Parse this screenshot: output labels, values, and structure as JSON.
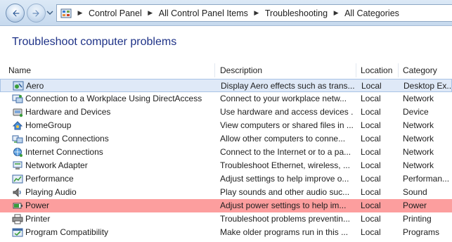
{
  "breadcrumb": [
    "Control Panel",
    "All Control Panel Items",
    "Troubleshooting",
    "All Categories"
  ],
  "page": {
    "title": "Troubleshoot computer problems"
  },
  "columns": {
    "name": "Name",
    "description": "Description",
    "location": "Location",
    "category": "Category"
  },
  "rows": [
    {
      "name": "Aero",
      "description": "Display Aero effects such as trans...",
      "location": "Local",
      "category": "Desktop Ex...",
      "icon": "aero-icon",
      "state": "selected"
    },
    {
      "name": "Connection to a Workplace Using DirectAccess",
      "description": "Connect to your workplace netw...",
      "location": "Local",
      "category": "Network",
      "icon": "directaccess-icon",
      "state": ""
    },
    {
      "name": "Hardware and Devices",
      "description": "Use hardware and access devices ...",
      "location": "Local",
      "category": "Device",
      "icon": "hardware-icon",
      "state": ""
    },
    {
      "name": "HomeGroup",
      "description": "View computers or shared files in ...",
      "location": "Local",
      "category": "Network",
      "icon": "homegroup-icon",
      "state": ""
    },
    {
      "name": "Incoming Connections",
      "description": "Allow other computers to conne...",
      "location": "Local",
      "category": "Network",
      "icon": "incoming-connections-icon",
      "state": ""
    },
    {
      "name": "Internet Connections",
      "description": "Connect to the Internet or to a pa...",
      "location": "Local",
      "category": "Network",
      "icon": "internet-connections-icon",
      "state": ""
    },
    {
      "name": "Network Adapter",
      "description": "Troubleshoot Ethernet, wireless, ...",
      "location": "Local",
      "category": "Network",
      "icon": "network-adapter-icon",
      "state": ""
    },
    {
      "name": "Performance",
      "description": "Adjust settings to help improve o...",
      "location": "Local",
      "category": "Performan...",
      "icon": "performance-icon",
      "state": ""
    },
    {
      "name": "Playing Audio",
      "description": "Play sounds and other audio suc...",
      "location": "Local",
      "category": "Sound",
      "icon": "audio-icon",
      "state": ""
    },
    {
      "name": "Power",
      "description": "Adjust power settings to help im...",
      "location": "Local",
      "category": "Power",
      "icon": "power-icon",
      "state": "highlight"
    },
    {
      "name": "Printer",
      "description": "Troubleshoot problems preventin...",
      "location": "Local",
      "category": "Printing",
      "icon": "printer-icon",
      "state": ""
    },
    {
      "name": "Program Compatibility",
      "description": "Make older programs run in this ...",
      "location": "Local",
      "category": "Programs",
      "icon": "program-compatibility-icon",
      "state": ""
    }
  ],
  "colors": {
    "title": "#1e3287",
    "highlight_row": "#fc9e9e",
    "selected_row": "#dfe9f7"
  }
}
